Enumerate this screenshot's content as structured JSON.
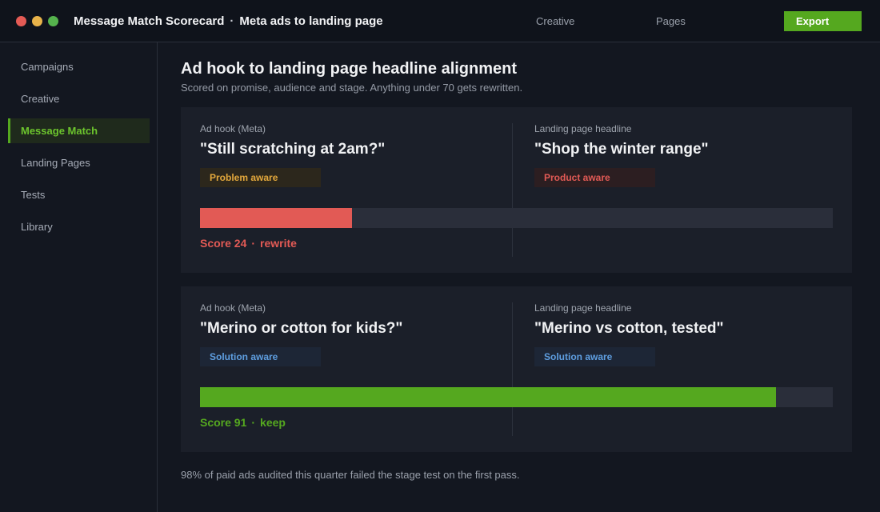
{
  "window": {
    "title": "Message Match Scorecard",
    "title_separator": "·",
    "subtitle": "Meta ads to landing page"
  },
  "header": {
    "nav": [
      {
        "label": "Creative"
      },
      {
        "label": "Pages"
      }
    ],
    "export_label": "Export"
  },
  "sidebar": {
    "items": [
      {
        "label": "Campaigns",
        "active": false
      },
      {
        "label": "Creative",
        "active": false
      },
      {
        "label": "Message Match",
        "active": true
      },
      {
        "label": "Landing Pages",
        "active": false
      },
      {
        "label": "Tests",
        "active": false
      },
      {
        "label": "Library",
        "active": false
      }
    ]
  },
  "main": {
    "title": "Ad hook to landing page headline alignment",
    "subtitle": "Scored on promise, audience and stage. Anything under 70 gets rewritten.",
    "pairs": [
      {
        "ad_label": "Ad hook (Meta)",
        "ad_quote": "\"Still scratching at 2am?\"",
        "ad_stage": "Problem aware",
        "page_label": "Landing page headline",
        "page_quote": "\"Shop the winter range\"",
        "page_stage": "Product aware",
        "score": 24,
        "score_label": "Score 24",
        "score_separator": "·",
        "verdict": "rewrite",
        "score_color": "#e25a55"
      },
      {
        "ad_label": "Ad hook (Meta)",
        "ad_quote": "\"Merino or cotton for kids?\"",
        "ad_stage": "Solution aware",
        "page_label": "Landing page headline",
        "page_quote": "\"Merino vs cotton, tested\"",
        "page_stage": "Solution aware",
        "score": 91,
        "score_label": "Score 91",
        "score_separator": "·",
        "verdict": "keep",
        "score_color": "#55a81f"
      }
    ],
    "footnote": "98% of paid ads audited this quarter failed the stage test on the first pass."
  },
  "colors": {
    "accent": "#55a81f",
    "fail": "#e25a55",
    "problem_aware": "#e3a83c",
    "solution_aware": "#5e9ee0"
  }
}
